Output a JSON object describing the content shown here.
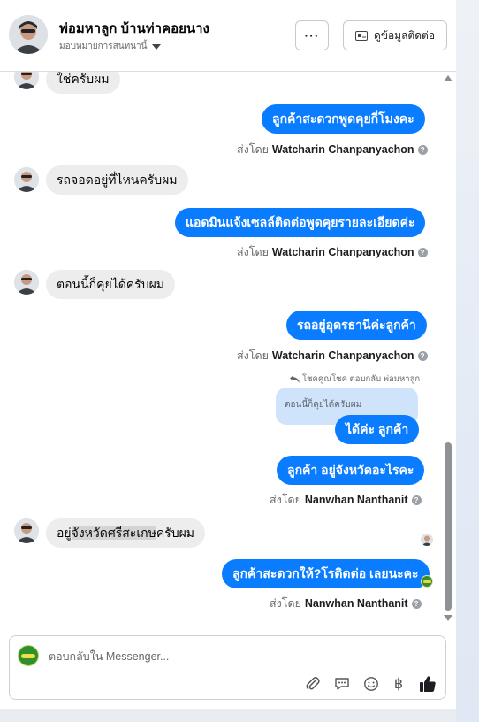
{
  "header": {
    "name": "พ่อมหาลูก บ้านท่าคอยนาง",
    "assignment": "มอบหมายการสนทนานี้",
    "more_label": "···",
    "contact_button": "ดูข้อมูลติดต่อ"
  },
  "messages": [
    {
      "direction": "in",
      "text": "ใช่ครับผม"
    },
    {
      "direction": "out",
      "text": "ลูกค้าสะดวกพูดคุยกี่โมงคะ",
      "sent_by_prefix": "ส่งโดย",
      "sent_by": "Watcharin Chanpanyachon"
    },
    {
      "direction": "in",
      "text": "รถจอดอยู่ที่ไหนครับผม"
    },
    {
      "direction": "out",
      "text": "แอดมินแจ้งเซลล์ติดต่อพูดคุยรายละเอียดค่ะ",
      "sent_by_prefix": "ส่งโดย",
      "sent_by": "Watcharin Chanpanyachon"
    },
    {
      "direction": "in",
      "text": "ตอนนี้ก็คุยได้ครับผม"
    },
    {
      "direction": "out",
      "text": "รถอยู่อุดรธานีค่ะลูกค้า",
      "sent_by_prefix": "ส่งโดย",
      "sent_by": "Watcharin Chanpanyachon"
    },
    {
      "direction": "out",
      "text": "ได้ค่ะ  ลูกค้า",
      "reply_context": "โชคคูณโชค ตอบกลับ พ่อมหาลูก",
      "quoted_text": "ตอนนี้ก็คุยได้ครับผม"
    },
    {
      "direction": "out",
      "text": "ลูกค้า อยู่จังหวัดอะไรคะ",
      "sent_by_prefix": "ส่งโดย",
      "sent_by": "Nanwhan Nanthanit"
    },
    {
      "direction": "in",
      "text_before": "อยู่",
      "text_highlight": "จังหวัดศรีสะเกษ",
      "text_after": "ครับผม"
    },
    {
      "direction": "out",
      "text": "ลูกค้าสะดวกให้?โรติดต่อ เลยนะคะ",
      "sent_by_prefix": "ส่งโดย",
      "sent_by": "Nanwhan Nanthanit"
    }
  ],
  "composer": {
    "placeholder": "ตอบกลับใน Messenger..."
  },
  "icons": {
    "attach": "paperclip-icon",
    "saved_replies": "chat-bubble-icon",
    "emoji": "smiley-icon",
    "payment": "baht-icon",
    "like": "thumbs-up-icon"
  },
  "colors": {
    "outgoing_bubble": "#0a7cff",
    "incoming_bubble": "#ededed"
  }
}
